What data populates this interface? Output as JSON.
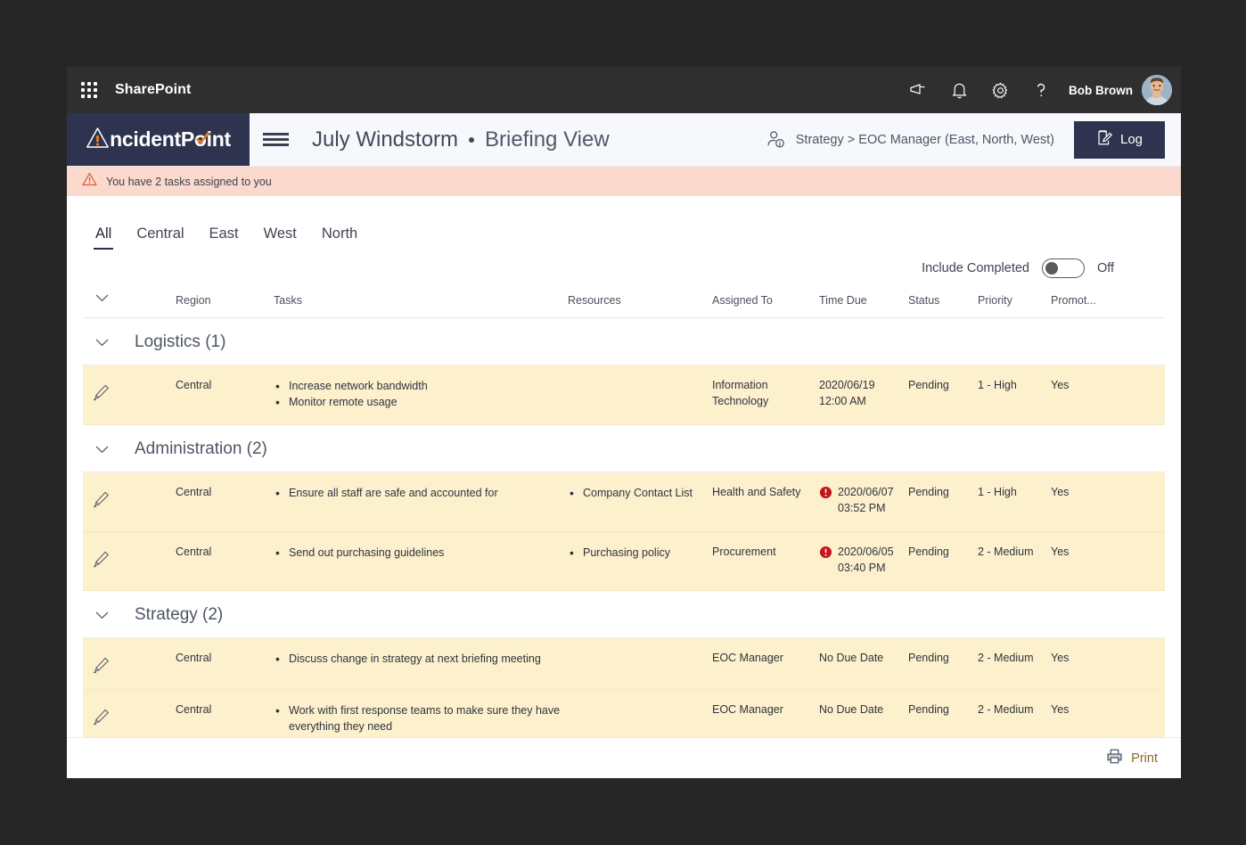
{
  "suite_bar": {
    "waffle_icon": "app-launcher-icon",
    "brand": "SharePoint",
    "icons": [
      {
        "name": "megaphone-icon",
        "title": "Announcements"
      },
      {
        "name": "bell-icon",
        "title": "Notifications"
      },
      {
        "name": "gear-icon",
        "title": "Settings"
      },
      {
        "name": "help-icon",
        "title": "Help"
      }
    ],
    "user_name": "Bob Brown",
    "avatar_alt": "Bob Brown"
  },
  "app_header": {
    "logo_text_pre": "!",
    "logo_text_mid": "ncidentP",
    "logo_text_o": "o",
    "logo_text_post": "int",
    "logo_full": "IncidentPoint",
    "menu_icon": "hamburger-menu-icon",
    "incident_name": "July Windstorm",
    "view_name": "Briefing View",
    "role_icon": "user-info-icon",
    "role_breadcrumb": "Strategy > EOC Manager (East, North, West)",
    "log_button": "Log",
    "log_icon": "edit-note-icon"
  },
  "alert": {
    "icon": "warning-triangle-icon",
    "message": "You have 2 tasks assigned to you"
  },
  "tabs": [
    {
      "label": "All",
      "active": true
    },
    {
      "label": "Central",
      "active": false
    },
    {
      "label": "East",
      "active": false
    },
    {
      "label": "West",
      "active": false
    },
    {
      "label": "North",
      "active": false
    }
  ],
  "filters": {
    "include_completed_label": "Include Completed",
    "include_completed_state": "Off"
  },
  "table": {
    "columns": [
      "",
      "",
      "Region",
      "Tasks",
      "Resources",
      "Assigned To",
      "Time Due",
      "Status",
      "Priority",
      "Promot..."
    ],
    "headers": {
      "region": "Region",
      "tasks": "Tasks",
      "resources": "Resources",
      "assigned_to": "Assigned To",
      "time_due": "Time Due",
      "status": "Status",
      "priority": "Priority",
      "promoted": "Promot..."
    },
    "groups": [
      {
        "title": "Logistics (1)",
        "rows": [
          {
            "region": "Central",
            "tasks": [
              "Increase network bandwidth",
              "Monitor remote usage"
            ],
            "resources": [],
            "assigned_to": "Information Technology",
            "time_due": "2020/06/19 12:00 AM",
            "time_due_date": "2020/06/19",
            "time_due_time": "12:00 AM",
            "overdue": false,
            "status": "Pending",
            "priority": "1 - High",
            "promoted": "Yes"
          }
        ]
      },
      {
        "title": "Administration (2)",
        "rows": [
          {
            "region": "Central",
            "tasks": [
              "Ensure all staff are safe and accounted for"
            ],
            "resources": [
              "Company Contact List"
            ],
            "assigned_to": "Health and Safety",
            "time_due": "2020/06/07 03:52 PM",
            "time_due_date": "2020/06/07",
            "time_due_time": "03:52 PM",
            "overdue": true,
            "status": "Pending",
            "priority": "1 - High",
            "promoted": "Yes"
          },
          {
            "region": "Central",
            "tasks": [
              "Send out purchasing guidelines"
            ],
            "resources": [
              "Purchasing policy"
            ],
            "assigned_to": "Procurement",
            "time_due": "2020/06/05 03:40 PM",
            "time_due_date": "2020/06/05",
            "time_due_time": "03:40 PM",
            "overdue": true,
            "status": "Pending",
            "priority": "2 - Medium",
            "promoted": "Yes"
          }
        ]
      },
      {
        "title": "Strategy (2)",
        "rows": [
          {
            "region": "Central",
            "tasks": [
              "Discuss change in strategy at next briefing meeting"
            ],
            "resources": [],
            "assigned_to": "EOC Manager",
            "time_due": "No Due Date",
            "time_due_date": "No Due Date",
            "time_due_time": "",
            "overdue": false,
            "status": "Pending",
            "priority": "2 - Medium",
            "promoted": "Yes"
          },
          {
            "region": "Central",
            "tasks": [
              "Work with first response teams to make sure they have everything they need"
            ],
            "resources": [],
            "assigned_to": "EOC Manager",
            "time_due": "No Due Date",
            "time_due_date": "No Due Date",
            "time_due_time": "",
            "overdue": false,
            "status": "Pending",
            "priority": "2 - Medium",
            "promoted": "Yes"
          }
        ]
      }
    ]
  },
  "footer": {
    "print_label": "Print",
    "print_icon": "printer-icon"
  },
  "colors": {
    "suite_bar_bg": "#2f2f2f",
    "brand_navy": "#2e3450",
    "alert_bg": "#fbd9cc",
    "row_bg": "#fcf0cd",
    "overdue_red": "#c3161c",
    "logo_orange": "#ef7d22",
    "print_gold": "#8a6a1e",
    "page_bg": "#262626"
  }
}
